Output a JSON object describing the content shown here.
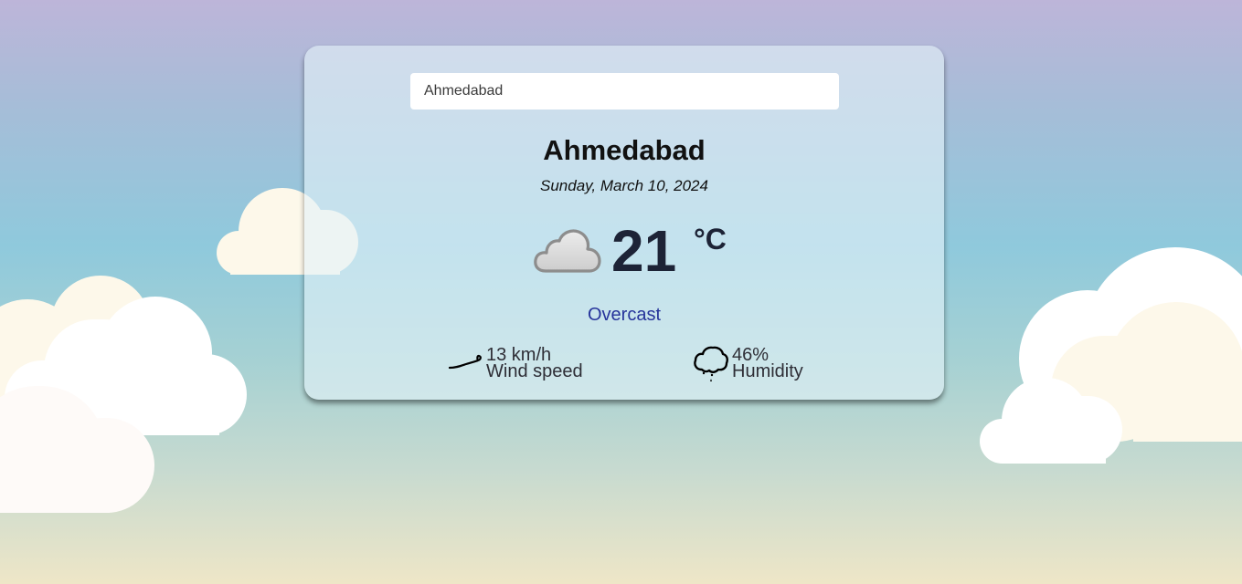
{
  "search": {
    "value": "Ahmedabad"
  },
  "location": {
    "city": "Ahmedabad",
    "date": "Sunday, March 10, 2024"
  },
  "current": {
    "temperature": "21",
    "unit": "°C",
    "icon": "cloud-icon",
    "condition": "Overcast"
  },
  "stats": {
    "wind": {
      "icon": "wind-icon",
      "value": "13 km/h",
      "label": "Wind speed"
    },
    "humidity": {
      "icon": "humidity-icon",
      "value": "46%",
      "label": "Humidity"
    }
  },
  "colors": {
    "condition_text": "#26349b",
    "temperature_text": "#1d2336"
  }
}
